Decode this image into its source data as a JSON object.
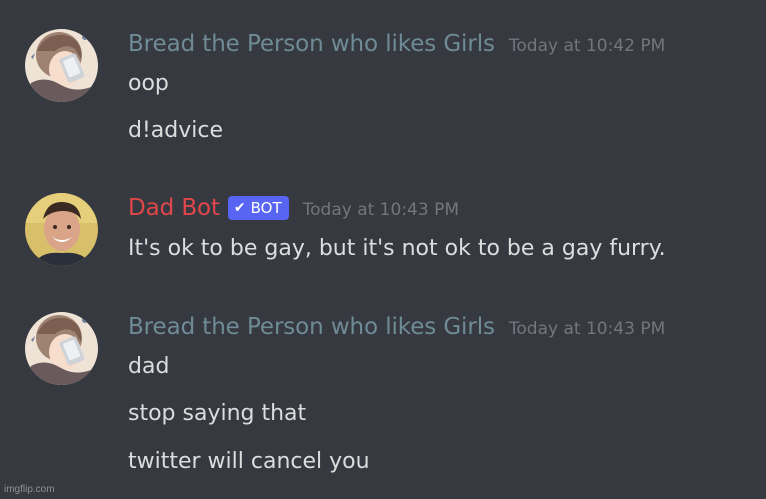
{
  "colors": {
    "background": "#36393f",
    "bread_author": "#6f8b96",
    "dad_author": "#e0474b",
    "timestamp": "#72767d",
    "message_text": "#dcddde",
    "bot_tag": "#5865f2"
  },
  "messages": [
    {
      "author": "Bread the Person who likes Girls",
      "timestamp": "Today at 10:42 PM",
      "lines": [
        "oop",
        "d!advice"
      ]
    },
    {
      "author": "Dad Bot",
      "bot_tag": "BOT",
      "bot_check_icon": "checkmark-icon",
      "timestamp": "Today at 10:43 PM",
      "lines": [
        "It's ok to be gay, but it's not ok to be a gay furry."
      ]
    },
    {
      "author": "Bread the Person who likes Girls",
      "timestamp": "Today at 10:43 PM",
      "lines": [
        "dad",
        "stop saying that",
        "twitter will cancel you"
      ]
    }
  ],
  "watermark": "imgflip.com"
}
